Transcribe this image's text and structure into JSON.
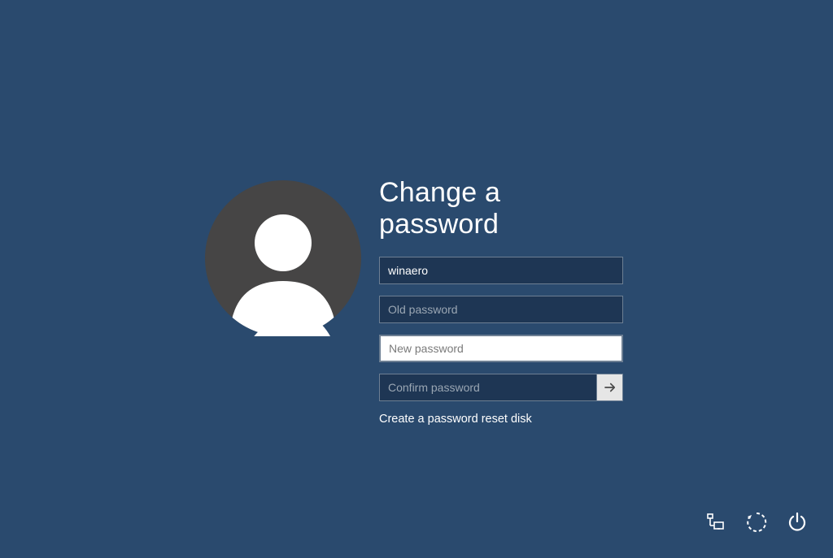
{
  "title": "Change a password",
  "fields": {
    "username": {
      "value": "winaero",
      "placeholder": ""
    },
    "old_password": {
      "value": "",
      "placeholder": "Old password"
    },
    "new_password": {
      "value": "",
      "placeholder": "New password"
    },
    "confirm_password": {
      "value": "",
      "placeholder": "Confirm password"
    }
  },
  "link_label": "Create a password reset disk",
  "icons": {
    "submit": "arrow-right-icon",
    "avatar": "user-avatar-icon",
    "network": "network-icon",
    "ease": "ease-of-access-icon",
    "power": "power-icon"
  },
  "colors": {
    "background": "#2a4a6e",
    "avatar_bg": "#464545",
    "field_bg": "#1e3654",
    "field_border": "#6d7f93",
    "active_bg": "#ffffff",
    "submit_bg": "#e6e6e6"
  }
}
